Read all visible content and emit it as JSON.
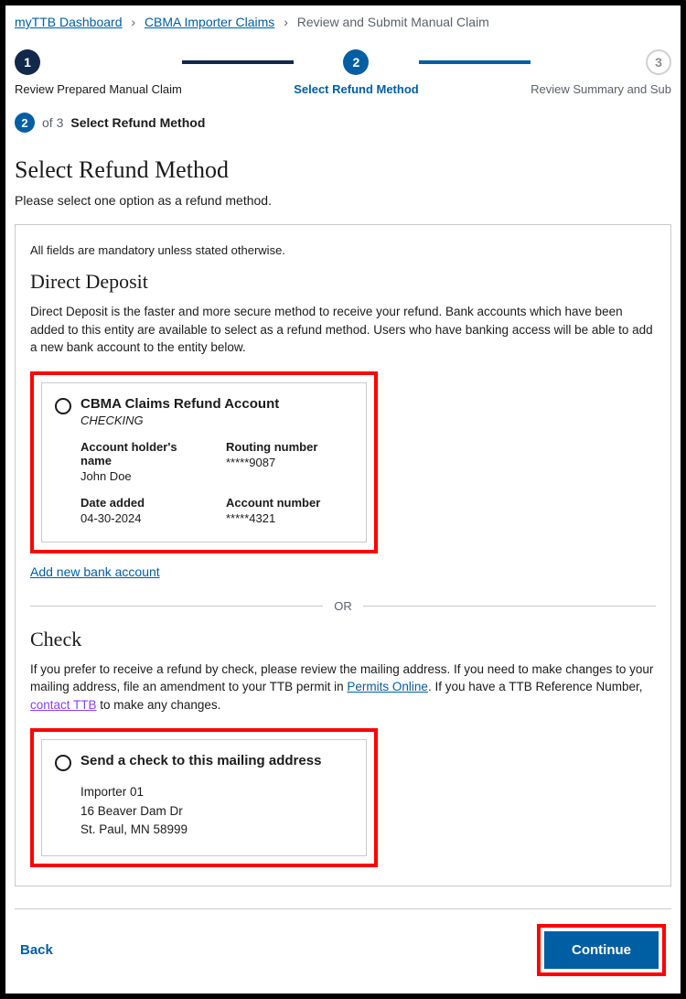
{
  "breadcrumb": {
    "items": [
      {
        "label": "myTTB Dashboard",
        "link": true
      },
      {
        "label": "CBMA Importer Claims",
        "link": true
      },
      {
        "label": "Review and Submit Manual Claim",
        "link": false
      }
    ]
  },
  "progress": {
    "steps": [
      {
        "num": "1",
        "label": "Review Prepared Manual Claim",
        "state": "done"
      },
      {
        "num": "2",
        "label": "Select Refund Method",
        "state": "active"
      },
      {
        "num": "3",
        "label": "Review Summary and Sub",
        "state": "upcoming"
      }
    ]
  },
  "step_indicator": {
    "current": "2",
    "of_text": "of 3",
    "title": "Select Refund Method"
  },
  "page": {
    "title": "Select Refund Method",
    "subtitle": "Please select one option as a refund method."
  },
  "panel": {
    "mandatory_note": "All fields are mandatory unless stated otherwise.",
    "direct_deposit": {
      "heading": "Direct Deposit",
      "desc": "Direct Deposit is the faster and more secure method to receive your refund. Bank accounts which have been added to this entity are available to select as a refund method. Users who have banking access will be able to add a new bank account to the entity below.",
      "option": {
        "title": "CBMA Claims Refund Account",
        "subtype": "CHECKING",
        "holder_label": "Account holder's name",
        "holder_value": "John Doe",
        "routing_label": "Routing number",
        "routing_value": "*****9087",
        "date_label": "Date added",
        "date_value": "04-30-2024",
        "acct_label": "Account number",
        "acct_value": "*****4321"
      },
      "add_link": "Add new bank account"
    },
    "divider_text": "OR",
    "check": {
      "heading": "Check",
      "desc_prefix": "If you prefer to receive a refund by check, please review the mailing address. If you need to make changes to your mailing address, file an amendment to your TTB permit in ",
      "permits_link": "Permits Online",
      "desc_mid": ". If you have a TTB Reference Number, ",
      "contact_link": "contact TTB",
      "desc_suffix": " to make any changes.",
      "option": {
        "title": "Send a check to this mailing address",
        "line1": "Importer 01",
        "line2": "16 Beaver Dam Dr",
        "line3": "St. Paul, MN 58999"
      }
    }
  },
  "footer": {
    "back": "Back",
    "continue": "Continue"
  }
}
